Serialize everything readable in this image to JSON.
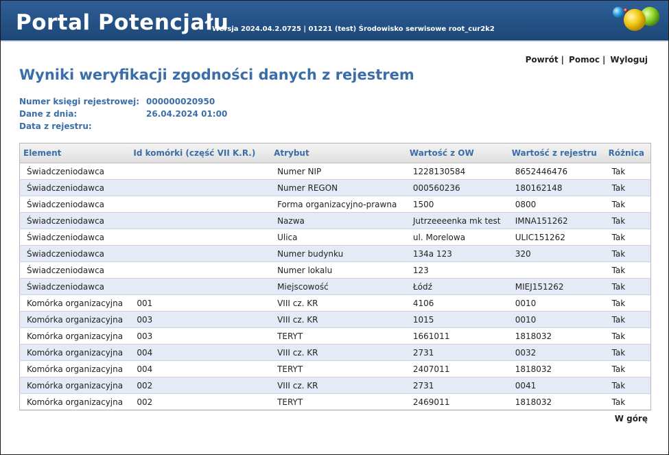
{
  "header": {
    "app_title": "Portal Potencjału",
    "version_info": "Wersja 2024.04.2.0725 | 01221 (test) Środowisko serwisowe root_cur2k2",
    "logo_icon": "colored-spheres-logo"
  },
  "nav": {
    "back": "Powrót",
    "help": "Pomoc",
    "logout": "Wyloguj",
    "separator": "|"
  },
  "page_title": "Wyniki weryfikacji zgodności danych z rejestrem",
  "info": {
    "register_number_label": "Numer księgi rejestrowej:",
    "register_number_value": "000000020950",
    "data_date_label": "Dane z dnia:",
    "data_date_value": "26.04.2024 01:00",
    "registry_date_label": "Data z rejestru:",
    "registry_date_value": ""
  },
  "table": {
    "headers": [
      "Element",
      "Id komórki (część VII K.R.)",
      "Atrybut",
      "Wartość z OW",
      "Wartość z rejestru",
      "Różnica"
    ],
    "rows": [
      [
        "Świadczeniodawca",
        "",
        "Numer NIP",
        "1228130584",
        "8652446476",
        "Tak"
      ],
      [
        "Świadczeniodawca",
        "",
        "Numer REGON",
        "000560236",
        "180162148",
        "Tak"
      ],
      [
        "Świadczeniodawca",
        "",
        "Forma organizacyjno-prawna",
        "1500",
        "0800",
        "Tak"
      ],
      [
        "Świadczeniodawca",
        "",
        "Nazwa",
        "Jutrzeeeenka mk test",
        "IMNA151262",
        "Tak"
      ],
      [
        "Świadczeniodawca",
        "",
        "Ulica",
        "ul. Morelowa",
        "ULIC151262",
        "Tak"
      ],
      [
        "Świadczeniodawca",
        "",
        "Numer budynku",
        "134a 123",
        "320",
        "Tak"
      ],
      [
        "Świadczeniodawca",
        "",
        "Numer lokalu",
        "123",
        "",
        "Tak"
      ],
      [
        "Świadczeniodawca",
        "",
        "Miejscowość",
        "Łódź",
        "MIEJ151262",
        "Tak"
      ],
      [
        "Komórka organizacyjna",
        "001",
        "VIII cz. KR",
        "4106",
        "0010",
        "Tak"
      ],
      [
        "Komórka organizacyjna",
        "003",
        "VIII cz. KR",
        "1015",
        "0010",
        "Tak"
      ],
      [
        "Komórka organizacyjna",
        "003",
        "TERYT",
        "1661011",
        "1818032",
        "Tak"
      ],
      [
        "Komórka organizacyjna",
        "004",
        "VIII cz. KR",
        "2731",
        "0032",
        "Tak"
      ],
      [
        "Komórka organizacyjna",
        "004",
        "TERYT",
        "2407011",
        "1818032",
        "Tak"
      ],
      [
        "Komórka organizacyjna",
        "002",
        "VIII cz. KR",
        "2731",
        "0041",
        "Tak"
      ],
      [
        "Komórka organizacyjna",
        "002",
        "TERYT",
        "2469011",
        "1818032",
        "Tak"
      ]
    ]
  },
  "footer": {
    "to_top": "W górę"
  }
}
